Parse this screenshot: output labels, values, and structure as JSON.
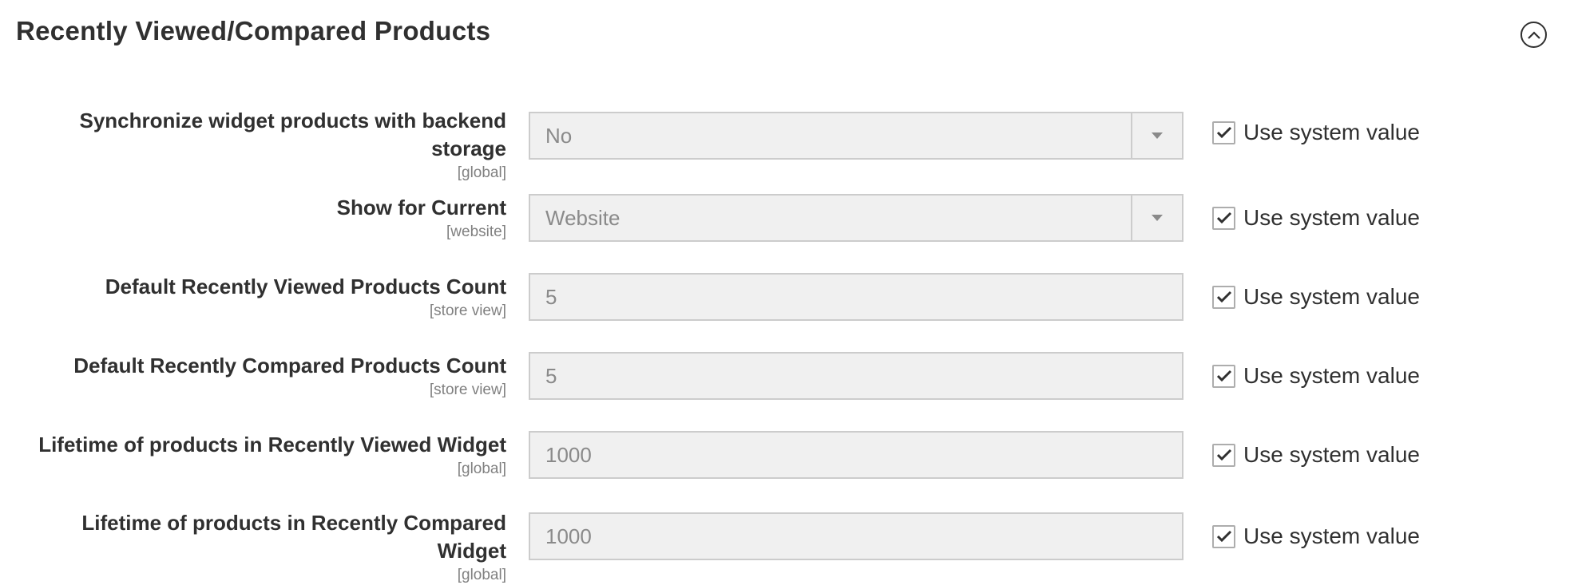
{
  "section": {
    "title": "Recently Viewed/Compared Products"
  },
  "rows": [
    {
      "label_line1": "Synchronize widget products with backend",
      "label_line2": "storage",
      "scope": "[global]",
      "type": "select",
      "value": "No",
      "use_system_label": "Use system value",
      "use_system_checked": true
    },
    {
      "label_line1": "Show for Current",
      "scope": "[website]",
      "type": "select",
      "value": "Website",
      "use_system_label": "Use system value",
      "use_system_checked": true
    },
    {
      "label_line1": "Default Recently Viewed Products Count",
      "scope": "[store view]",
      "type": "input",
      "value": "5",
      "use_system_label": "Use system value",
      "use_system_checked": true
    },
    {
      "label_line1": "Default Recently Compared Products Count",
      "scope": "[store view]",
      "type": "input",
      "value": "5",
      "use_system_label": "Use system value",
      "use_system_checked": true
    },
    {
      "label_line1": "Lifetime of products in Recently Viewed Widget",
      "scope": "[global]",
      "type": "input",
      "value": "1000",
      "use_system_label": "Use system value",
      "use_system_checked": true
    },
    {
      "label_line1": "Lifetime of products in Recently Compared",
      "label_line2": "Widget",
      "scope": "[global]",
      "type": "input",
      "value": "1000",
      "use_system_label": "Use system value",
      "use_system_checked": true
    }
  ],
  "icons": {
    "collapse": "chevron-up-circle-icon",
    "select_arrow": "caret-down-icon",
    "check": "checkmark-icon"
  }
}
